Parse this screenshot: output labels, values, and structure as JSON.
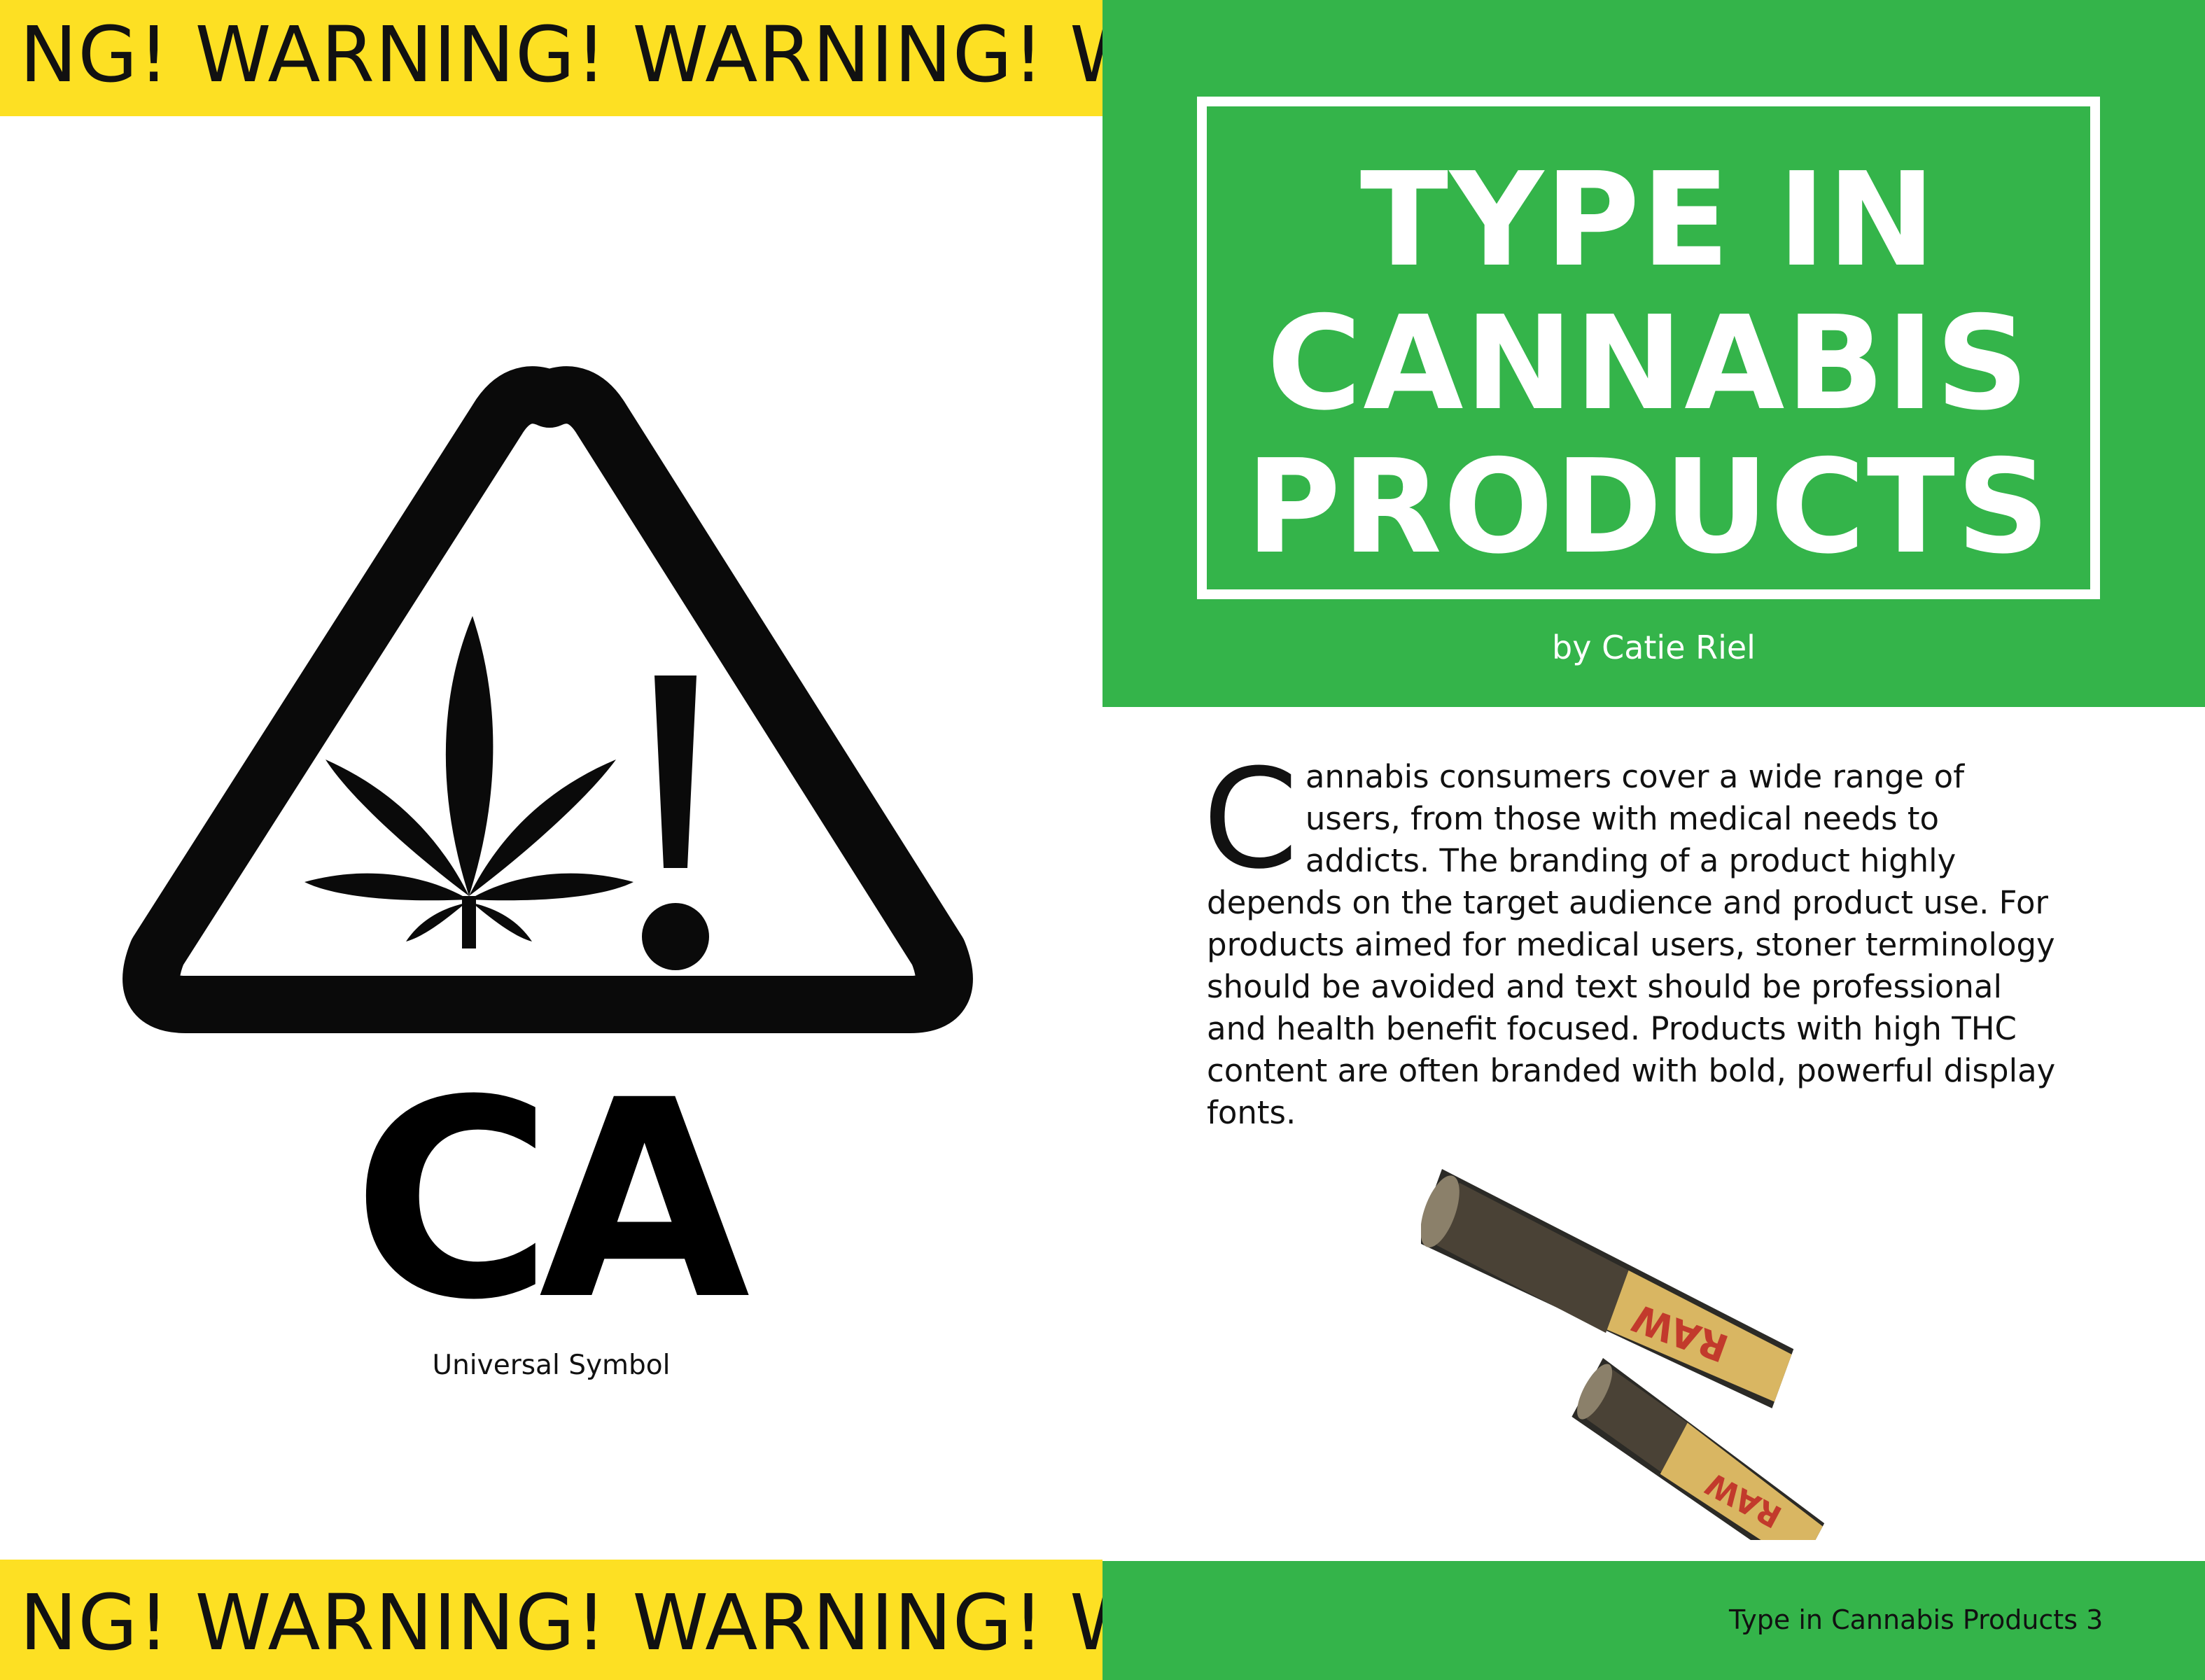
{
  "warning_band": {
    "text": "NG! WARNING! WARNING! WA"
  },
  "title": {
    "line1": "TYPE IN",
    "line2": "CANNABIS",
    "line3": "PRODUCTS"
  },
  "byline": "by Catie Riel",
  "article": {
    "drop_cap": "C",
    "body": "annabis consumers cover a wide range of users, from those with medical needs to addicts. The branding of a product highly depends on the target audience and product use. For products aimed for medical users, stoner terminology should be avoided and text should be professional and health benefit focused. Products with high THC content are often branded with bold, powerful display fonts."
  },
  "symbol": {
    "label": "CA",
    "caption": "Universal Symbol"
  },
  "photo": {
    "brand_text": "RAW"
  },
  "footer": {
    "page_label": "Type in Cannabis Products 3"
  },
  "colors": {
    "yellow": "#fde023",
    "green": "#34b44a",
    "black": "#0a0a0a",
    "white": "#ffffff"
  }
}
